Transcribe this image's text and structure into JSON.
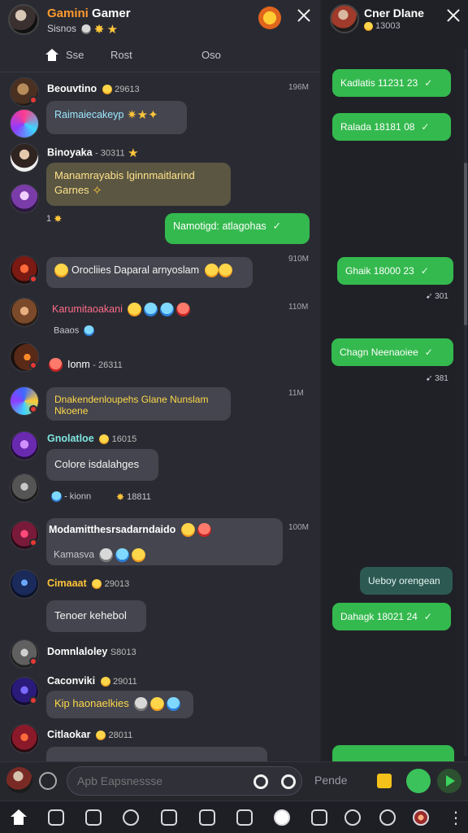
{
  "left_header": {
    "title_orange": "Gamini",
    "title_white": "Gamer",
    "subtitle": "Sisnos"
  },
  "tabs": [
    "Sse",
    "Rost",
    "Oso"
  ],
  "messages": [
    {
      "name": "Beouvtino",
      "meta": "29613",
      "time": "196M",
      "text": "Raimaiecakeyp"
    },
    {
      "name": "Binoyaka",
      "meta": "- 30311",
      "text": "Manamrayabis lginnmaitlarind Garnes",
      "after": "1"
    },
    {
      "own": "Namotigd: atlagohas"
    },
    {
      "time": "910M",
      "text": "Orocliies Daparal arnyoslam"
    },
    {
      "name": "Karumitaoakani",
      "time": "110M",
      "sub": "Baaos"
    },
    {
      "name": "Ionm",
      "meta": "- 26311"
    },
    {
      "time": "11M",
      "text": "Dnakendenloupehs Glane Nunslam Nkoene"
    },
    {
      "name": "Gnolatloe",
      "meta": "16015",
      "text": "Colore isdalahges"
    },
    {
      "meta_a": "- kionn",
      "meta_b": "18811"
    },
    {
      "name": "Modamitthesrsadarndaido",
      "time": "100M",
      "sub": "Kamasva"
    },
    {
      "name": "Cimaaat",
      "meta": "29013",
      "text": "Tenoer kehebol"
    },
    {
      "name": "Domnlaloley",
      "meta": "S8013"
    },
    {
      "name": "Caconviki",
      "meta": "29011",
      "text": "Kip haonaelkies"
    },
    {
      "name": "Citlaokar",
      "meta": "28011"
    }
  ],
  "right_header": {
    "title": "Cner Dlane",
    "subtitle": "13003"
  },
  "right_messages": [
    {
      "text": "Kadlatis 11231 23"
    },
    {
      "text": "Ralada 18181 08"
    },
    {
      "text": "Ghaik 18000 23",
      "note": "301"
    },
    {
      "text": "Chagn Neenaoiee",
      "note": "381"
    },
    {
      "text": "Ueboy orengean",
      "dark": true
    },
    {
      "text": "Dahagk 18021 24"
    }
  ],
  "composer": {
    "placeholder": "Apb Eapsnessse",
    "panel": "Pende"
  },
  "nav_icons": [
    "home-icon",
    "square-icon",
    "check-square-icon",
    "pen-icon",
    "briefcase-icon",
    "list-icon",
    "chat-icon",
    "badge-icon",
    "games-icon",
    "clock-icon",
    "search-icon",
    "avatar-icon",
    "more-icon"
  ],
  "colors": {
    "accent_green": "#34b94e",
    "title_orange": "#ff9a2e",
    "gold_text": "#ffe28a"
  }
}
